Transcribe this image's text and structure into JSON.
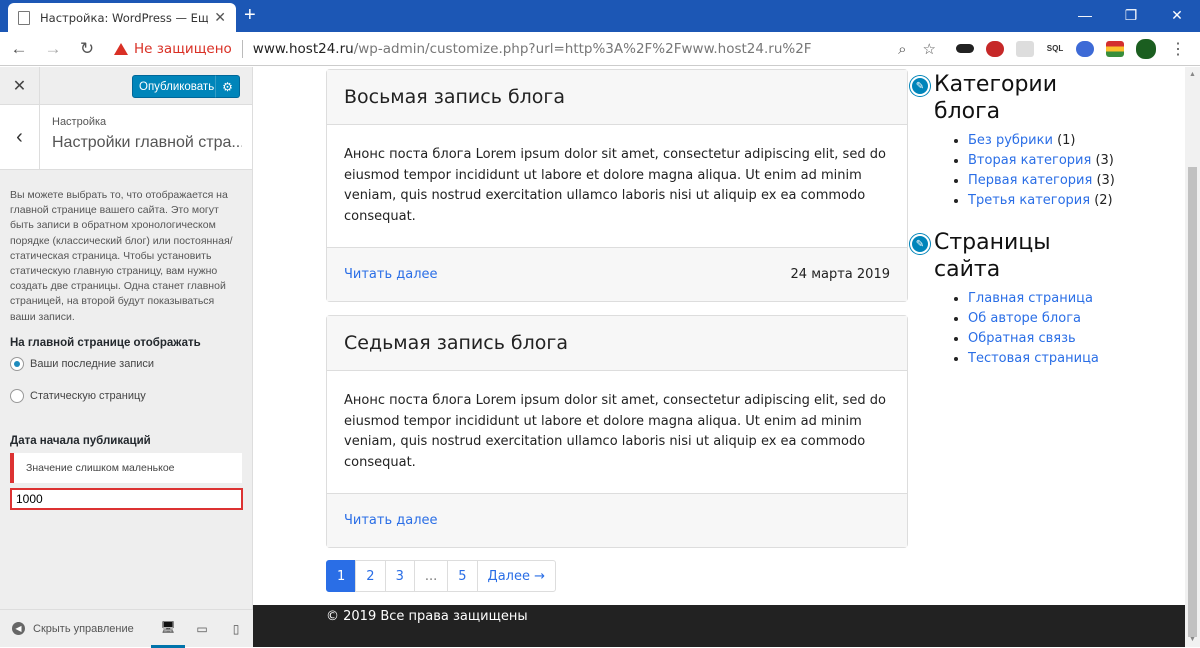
{
  "browser": {
    "tab_title": "Настройка: WordPress — Ещё од",
    "tab_close": "✕",
    "new_tab": "+",
    "win_min": "—",
    "win_max": "❐",
    "win_close": "✕",
    "back": "←",
    "forward": "→",
    "reload": "↻",
    "insecure_label": "Не защищено",
    "url_host": "www.host24.ru",
    "url_rest": "/wp-admin/customize.php?url=http%3A%2F%2Fwww.host24.ru%2F",
    "zoom_icon": "⌕",
    "star_icon": "☆",
    "ext_sql": "SQL",
    "menu": "⋮"
  },
  "sidebar": {
    "close": "✕",
    "publish_label": "Опубликовать",
    "gear": "⚙",
    "back": "‹",
    "crumb": "Настройка",
    "title": "Настройки главной стра...",
    "description": "Вы можете выбрать то, что отображается на главной странице вашего сайта. Это могут быть записи в обратном хронологическом порядке (классический блог) или постоянная/статическая страница. Чтобы установить статическую главную страницу, вам нужно создать две страницы. Одна станет главной страницей, на второй будут показываться ваши записи.",
    "homepage_label": "На главной странице отображать",
    "option_latest": "Ваши последние записи",
    "option_static": "Статическую страницу",
    "date_label": "Дата начала публикаций",
    "error_notice": "Значение слишком маленькое",
    "date_value": "1000",
    "hide_controls": "Скрыть управление",
    "hide_icon": "◀",
    "dev_desktop": "🖥",
    "dev_tablet": "▭",
    "dev_mobile": "▯"
  },
  "posts": [
    {
      "title": "Восьмая запись блога",
      "excerpt": "Анонс поста блога Lorem ipsum dolor sit amet, consectetur adipiscing elit, sed do eiusmod tempor incididunt ut labore et dolore magna aliqua. Ut enim ad minim veniam, quis nostrud exercitation ullamco laboris nisi ut aliquip ex ea commodo consequat.",
      "read_more": "Читать далее",
      "date": "24 марта 2019"
    },
    {
      "title": "Седьмая запись блога",
      "excerpt": "Анонс поста блога Lorem ipsum dolor sit amet, consectetur adipiscing elit, sed do eiusmod tempor incididunt ut labore et dolore magna aliqua. Ut enim ad minim veniam, quis nostrud exercitation ullamco laboris nisi ut aliquip ex ea commodo consequat.",
      "read_more": "Читать далее",
      "date": ""
    }
  ],
  "pagination": {
    "pages": [
      "1",
      "2",
      "3",
      "...",
      "5"
    ],
    "next": "Далее →",
    "current": "1"
  },
  "widgets": {
    "categories_title": "Категории блога",
    "categories": [
      {
        "name": "Без рубрики",
        "count": "(1)"
      },
      {
        "name": "Вторая категория",
        "count": "(3)"
      },
      {
        "name": "Первая категория",
        "count": "(3)"
      },
      {
        "name": "Третья категория",
        "count": "(2)"
      }
    ],
    "pages_title": "Страницы сайта",
    "pages": [
      "Главная страница",
      "Об авторе блога",
      "Обратная связь",
      "Тестовая страница"
    ],
    "edit_icon": "✎"
  },
  "footer": {
    "text": "© 2019 Все права защищены"
  },
  "colors": {
    "accent": "#0085ba",
    "link": "#2a6ee6",
    "error": "#dc3232",
    "tabbar": "#1c57b5"
  }
}
